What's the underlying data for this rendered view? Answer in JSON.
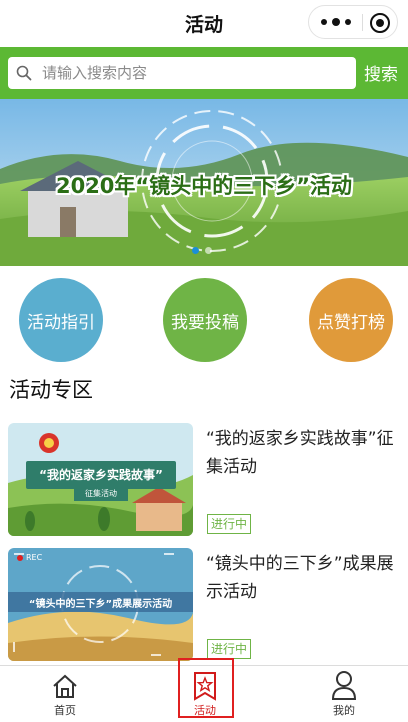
{
  "header": {
    "title": "活动"
  },
  "search": {
    "placeholder": "请输入搜索内容",
    "button_label": "搜索"
  },
  "banner": {
    "text": "2020年“镜头中的三下乡”活动",
    "dots": 2,
    "active_dot": 0
  },
  "quick_actions": [
    {
      "label": "活动指引",
      "color": "#5aaecf"
    },
    {
      "label": "我要投稿",
      "color": "#6fb446"
    },
    {
      "label": "点赞打榜",
      "color": "#e09a3a"
    }
  ],
  "section": {
    "title": "活动专区"
  },
  "activities": [
    {
      "title": "“我的返家乡实践故事”征集活动",
      "status": "进行中",
      "thumb_text": "“我的返家乡实践故事”",
      "thumb_sub": "征集活动"
    },
    {
      "title": "“镜头中的三下乡”成果展示活动",
      "status": "进行中",
      "thumb_text": "“镜头中的三下乡”成果展示活动",
      "thumb_rec": "REC"
    }
  ],
  "tabs": [
    {
      "label": "首页",
      "icon": "home-icon"
    },
    {
      "label": "活动",
      "icon": "star-bookmark-icon",
      "active": true
    },
    {
      "label": "我的",
      "icon": "user-icon"
    }
  ],
  "colors": {
    "brand_green": "#5cb834",
    "active_tab": "#d11b1b",
    "status_green": "#6fb446"
  }
}
